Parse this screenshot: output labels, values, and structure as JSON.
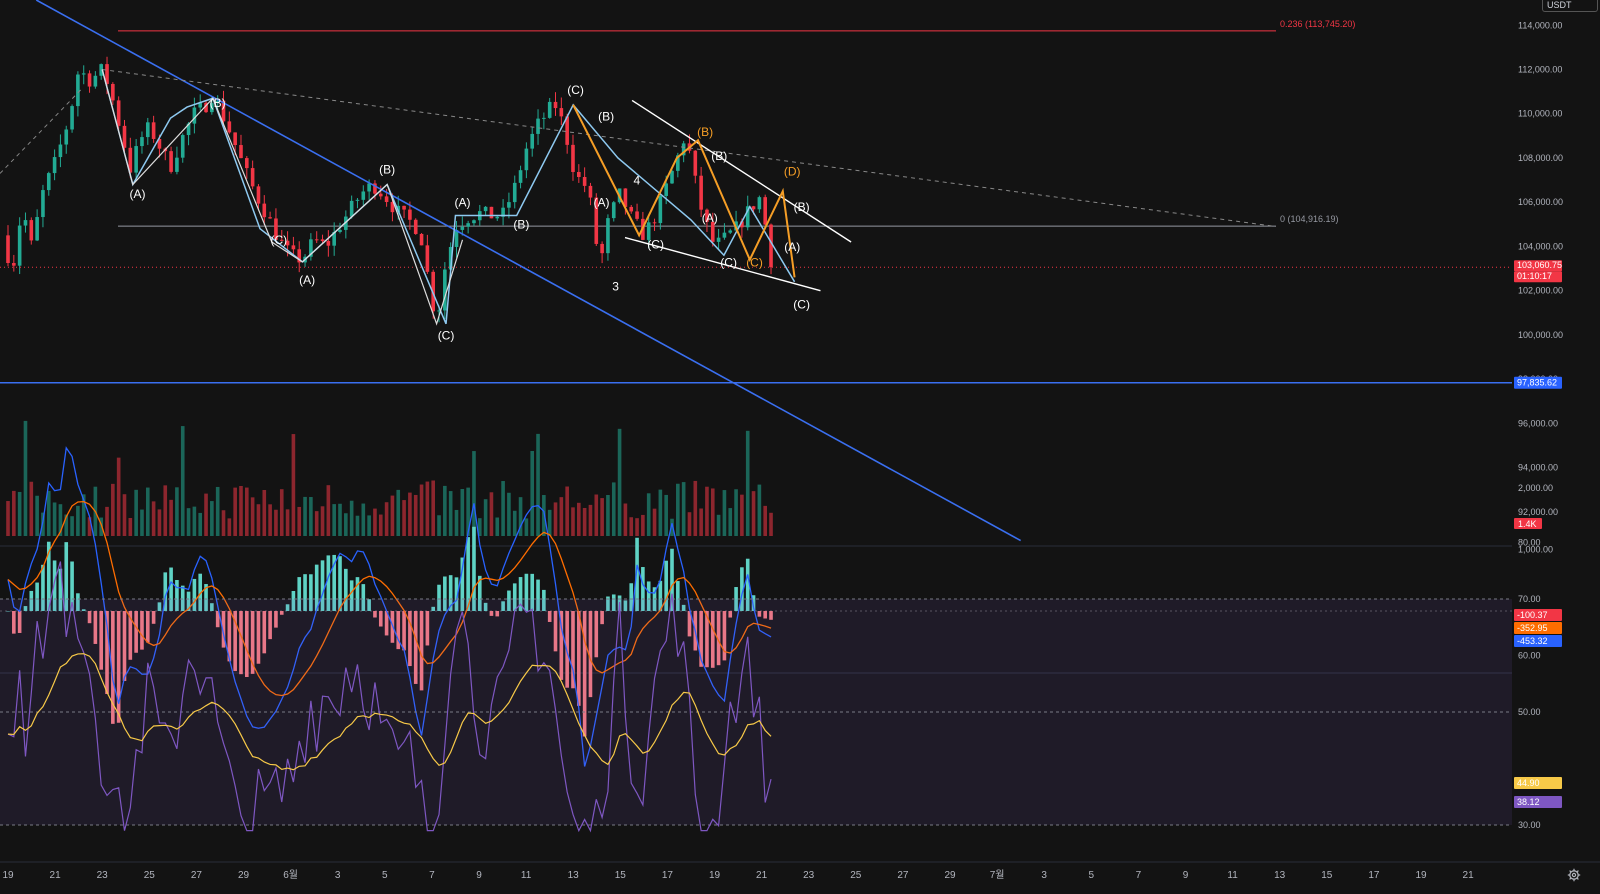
{
  "header": {
    "unit_label": "USDT"
  },
  "chart_data": [
    {
      "type": "candlestick",
      "title": "",
      "ylim": [
        90500,
        115800
      ],
      "y_ticks": [
        "114,000.00",
        "112,000.00",
        "110,000.00",
        "108,000.00",
        "106,000.00",
        "104,000.00",
        "102,000.00",
        "100,000.00",
        "98,000.00",
        "96,000.00",
        "94,000.00",
        "92,000.00"
      ],
      "y_tick_values": [
        114000,
        112000,
        110000,
        108000,
        106000,
        104000,
        102000,
        100000,
        98000,
        96000,
        94000,
        92000
      ],
      "x_ticks": [
        "19",
        "21",
        "23",
        "25",
        "27",
        "29",
        "6월",
        "3",
        "5",
        "7",
        "9",
        "11",
        "13",
        "15",
        "17",
        "19",
        "21",
        "23",
        "25",
        "27",
        "29",
        "7월",
        "3",
        "5",
        "7",
        "9",
        "11",
        "13",
        "15",
        "17",
        "19",
        "21"
      ],
      "x_tick_days": [
        0,
        2,
        4,
        6,
        8,
        10,
        12,
        14,
        16,
        18,
        20,
        22,
        24,
        26,
        28,
        30,
        32,
        34,
        36,
        38,
        40,
        42,
        44,
        46,
        48,
        50,
        52,
        54,
        56,
        58,
        60,
        62
      ],
      "grid": false,
      "price_label": "103,060.75",
      "countdown_label": "01:10:17",
      "horizontal_line_label": "97,835.62",
      "horizontal_line_value": 97835.62,
      "fib_levels": [
        {
          "label": "0.236 (113,745.20)",
          "value": 113745.2,
          "color": "#f23645"
        },
        {
          "label": "0 (104,916.19)",
          "value": 104916.19,
          "color": "#9598a1"
        }
      ],
      "close_path": [
        [
          -0.3,
          104500
        ],
        [
          0.2,
          103000
        ],
        [
          0.6,
          105800
        ],
        [
          1.0,
          104000
        ],
        [
          1.5,
          106500
        ],
        [
          2.0,
          107800
        ],
        [
          2.6,
          109800
        ],
        [
          3.0,
          112000
        ],
        [
          3.5,
          111500
        ],
        [
          4.0,
          112000
        ],
        [
          4.3,
          111200
        ],
        [
          4.8,
          109200
        ],
        [
          5.2,
          107500
        ],
        [
          5.6,
          108800
        ],
        [
          6.0,
          109400
        ],
        [
          6.4,
          108600
        ],
        [
          6.9,
          107600
        ],
        [
          7.4,
          108900
        ],
        [
          7.9,
          110000
        ],
        [
          8.4,
          110400
        ],
        [
          8.7,
          110900
        ],
        [
          9.0,
          110200
        ],
        [
          9.5,
          109000
        ],
        [
          10.0,
          107600
        ],
        [
          10.5,
          106400
        ],
        [
          11.0,
          105400
        ],
        [
          11.5,
          104300
        ],
        [
          12.0,
          103600
        ],
        [
          12.5,
          103400
        ],
        [
          13.0,
          104300
        ],
        [
          13.5,
          104000
        ],
        [
          14.0,
          104800
        ],
        [
          14.5,
          105600
        ],
        [
          15.0,
          106400
        ],
        [
          15.5,
          106800
        ],
        [
          16.0,
          106300
        ],
        [
          16.5,
          105600
        ],
        [
          17.0,
          105200
        ],
        [
          17.5,
          104700
        ],
        [
          17.9,
          102200
        ],
        [
          18.2,
          100500
        ],
        [
          18.5,
          102800
        ],
        [
          19.0,
          104900
        ],
        [
          19.5,
          105300
        ],
        [
          20.0,
          105500
        ],
        [
          20.5,
          105400
        ],
        [
          21.0,
          105400
        ],
        [
          21.5,
          106600
        ],
        [
          22.0,
          108400
        ],
        [
          22.5,
          109500
        ],
        [
          23.0,
          110200
        ],
        [
          23.3,
          110400
        ],
        [
          23.7,
          109000
        ],
        [
          24.0,
          107600
        ],
        [
          24.3,
          106900
        ],
        [
          24.6,
          106700
        ],
        [
          24.9,
          105000
        ],
        [
          25.1,
          102900
        ],
        [
          25.5,
          105200
        ],
        [
          26.0,
          106400
        ],
        [
          26.4,
          105400
        ],
        [
          27.0,
          104500
        ],
        [
          27.5,
          105400
        ],
        [
          28.0,
          106800
        ],
        [
          28.5,
          108200
        ],
        [
          28.8,
          109200
        ],
        [
          29.0,
          107800
        ],
        [
          29.5,
          105400
        ],
        [
          30.0,
          104000
        ],
        [
          30.5,
          104400
        ],
        [
          31.0,
          104900
        ],
        [
          31.5,
          105700
        ],
        [
          32.0,
          106300
        ],
        [
          32.2,
          104600
        ],
        [
          32.4,
          103500
        ]
      ],
      "volume_ylim": [
        0,
        1400
      ],
      "volume_note": "1.4K",
      "annotations": [
        {
          "text": "(B)",
          "day": 8.9,
          "price": 110300,
          "color": "#ffffff"
        },
        {
          "text": "(A)",
          "day": 5.5,
          "price": 106200,
          "color": "#ffffff"
        },
        {
          "text": "(C)",
          "day": 11.5,
          "price": 104100,
          "color": "#ffffff"
        },
        {
          "text": "(A)",
          "day": 12.7,
          "price": 102300,
          "color": "#ffffff"
        },
        {
          "text": "(B)",
          "day": 16.1,
          "price": 107300,
          "color": "#ffffff"
        },
        {
          "text": "(C)",
          "day": 18.6,
          "price": 99800,
          "color": "#ffffff"
        },
        {
          "text": "(A)",
          "day": 19.3,
          "price": 105800,
          "color": "#ffffff"
        },
        {
          "text": "(B)",
          "day": 21.8,
          "price": 104800,
          "color": "#ffffff"
        },
        {
          "text": "(C)",
          "day": 24.1,
          "price": 110900,
          "color": "#ffffff"
        },
        {
          "text": "(B)",
          "day": 25.4,
          "price": 109700,
          "color": "#ffffff"
        },
        {
          "text": "(A)",
          "day": 25.2,
          "price": 105800,
          "color": "#ffffff"
        },
        {
          "text": "3",
          "day": 25.8,
          "price": 102000,
          "color": "#ffffff"
        },
        {
          "text": "4",
          "day": 26.7,
          "price": 106800,
          "color": "#ffffff"
        },
        {
          "text": "(C)",
          "day": 27.5,
          "price": 103900,
          "color": "#ffffff"
        },
        {
          "text": "(B)",
          "day": 29.6,
          "price": 109000,
          "color": "#f59e26"
        },
        {
          "text": "(B)",
          "day": 30.2,
          "price": 107900,
          "color": "#ffffff"
        },
        {
          "text": "(A)",
          "day": 29.8,
          "price": 105100,
          "color": "#ffffff"
        },
        {
          "text": "(C)",
          "day": 30.6,
          "price": 103100,
          "color": "#ffffff"
        },
        {
          "text": "(C)",
          "day": 31.7,
          "price": 103100,
          "color": "#f59e26"
        },
        {
          "text": "(D)",
          "day": 33.3,
          "price": 107200,
          "color": "#f59e26"
        },
        {
          "text": "(B)",
          "day": 33.7,
          "price": 105600,
          "color": "#ffffff"
        },
        {
          "text": "(A)",
          "day": 33.3,
          "price": 103800,
          "color": "#ffffff"
        },
        {
          "text": "(C)",
          "day": 33.7,
          "price": 101200,
          "color": "#ffffff"
        }
      ]
    },
    {
      "type": "line",
      "title": "",
      "ylim": [
        -1600,
        2200
      ],
      "y_ticks": [
        "2,000.00",
        "1,000.00"
      ],
      "y_tick_values": [
        2000,
        1000
      ],
      "series": [
        {
          "values_label": "-100.37",
          "color": "#f23645"
        },
        {
          "values_label": "-352.95",
          "color": "#ff6d00"
        },
        {
          "values_label": "-453.32",
          "color": "#2962ff"
        }
      ]
    },
    {
      "type": "line",
      "title": "",
      "ylim": [
        26,
        84
      ],
      "y_ticks": [
        "80.00",
        "70.00",
        "60.00",
        "50.00",
        "30.00"
      ],
      "y_tick_values": [
        80,
        70,
        60,
        50,
        30
      ],
      "band": [
        30,
        70
      ],
      "series": [
        {
          "values_label": "44.90",
          "color": "#f7c948"
        },
        {
          "values_label": "38.12",
          "color": "#7e57c2"
        }
      ]
    }
  ],
  "colors": {
    "background": "#131313",
    "up": "#22ab94",
    "down": "#f23645",
    "trend_line": "#3a6ff0",
    "wave_cyan": "#8ec9f0",
    "wave_orange": "#f59e26"
  },
  "icons": {
    "settings": "gear-icon"
  }
}
